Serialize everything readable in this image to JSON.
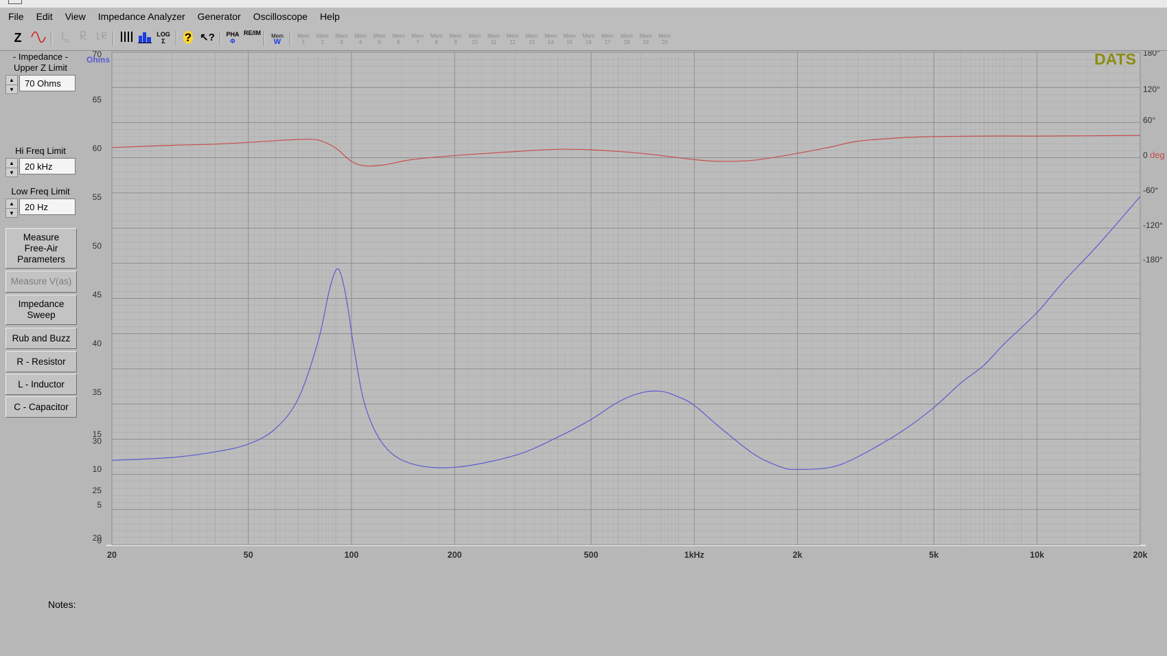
{
  "menubar": [
    "File",
    "Edit",
    "View",
    "Impedance Analyzer",
    "Generator",
    "Oscilloscope",
    "Help"
  ],
  "toolbar": {
    "z_label": "Z",
    "log_label": "LOG",
    "pha_label": "PHA",
    "re_im_label": "RE/IM",
    "mem_label": "Mem",
    "mem_slots": [
      "Mem 1",
      "Mem 2",
      "Mem 3",
      "Mem 4",
      "Mem 5",
      "Mem 6",
      "Mem 7",
      "Mem 8",
      "Mem 9",
      "Mem 10",
      "Mem 11",
      "Mem 12",
      "Mem 13",
      "Mem 14",
      "Mem 15",
      "Mem 16",
      "Mem 17",
      "Mem 18",
      "Mem 19",
      "Mem 20"
    ]
  },
  "sidebar": {
    "impedance_group": "- Impedance -",
    "upper_z_label": "Upper Z Limit",
    "upper_z_value": "70 Ohms",
    "hi_freq_label": "Hi Freq Limit",
    "hi_freq_value": "20 kHz",
    "low_freq_label": "Low Freq Limit",
    "low_freq_value": "20 Hz",
    "buttons": {
      "measure_free_air": [
        "Measure",
        "Free-Air",
        "Parameters"
      ],
      "measure_vas": "Measure V(as)",
      "impedance_sweep": [
        "Impedance",
        "Sweep"
      ],
      "rub_and_buzz": "Rub and Buzz",
      "r_resistor": "R - Resistor",
      "l_inductor": "L - Inductor",
      "c_capacitor": "C - Capacitor"
    }
  },
  "notes_label": "Notes:",
  "colors": {
    "impedance": "#5a5ad2",
    "phase": "#c84c4c",
    "brand": "#8c8c14",
    "grid_major": "#8c8c8c",
    "grid_minor": "#a7a7a7"
  },
  "chart_data": {
    "type": "line",
    "brand": "DATS",
    "x_scale": "log",
    "xlim": [
      20,
      20000
    ],
    "x_ticks": [
      20,
      50,
      100,
      200,
      500,
      1000,
      2000,
      5000,
      10000,
      20000
    ],
    "x_tick_labels": [
      "20",
      "50",
      "100",
      "200",
      "500",
      "1kHz",
      "2k",
      "5k",
      "10k",
      "20k"
    ],
    "y_unit_label": "Ohms",
    "y_tick_labels": [
      "70",
      "65",
      "60",
      "55",
      "50",
      "45",
      "40",
      "35",
      "15",
      "30",
      "10",
      "25",
      "5",
      "20",
      "0"
    ],
    "y2_unit_label": "deg",
    "y2lim": [
      -180,
      180
    ],
    "y2_tick_labels": [
      "180°",
      "120°",
      "60°",
      "0",
      "-60°",
      "-120°",
      "-180°"
    ],
    "grid": true,
    "series": [
      {
        "key": "impedance",
        "axis": "left",
        "points": [
          [
            20,
            12.0
          ],
          [
            30,
            12.4
          ],
          [
            40,
            13.2
          ],
          [
            50,
            14.3
          ],
          [
            60,
            16.5
          ],
          [
            70,
            20.8
          ],
          [
            80,
            29.0
          ],
          [
            86,
            36.0
          ],
          [
            90,
            39.0
          ],
          [
            93,
            38.5
          ],
          [
            97,
            34.5
          ],
          [
            102,
            27.5
          ],
          [
            110,
            19.5
          ],
          [
            125,
            14.0
          ],
          [
            150,
            11.5
          ],
          [
            200,
            11.0
          ],
          [
            300,
            12.7
          ],
          [
            400,
            15.3
          ],
          [
            500,
            17.8
          ],
          [
            600,
            20.3
          ],
          [
            700,
            21.6
          ],
          [
            800,
            21.8
          ],
          [
            900,
            21.0
          ],
          [
            1000,
            19.8
          ],
          [
            1200,
            16.5
          ],
          [
            1500,
            12.8
          ],
          [
            1800,
            11.0
          ],
          [
            2000,
            10.7
          ],
          [
            2500,
            11.0
          ],
          [
            3000,
            12.5
          ],
          [
            4000,
            16.0
          ],
          [
            5000,
            19.5
          ],
          [
            6000,
            23.0
          ],
          [
            7000,
            25.5
          ],
          [
            8000,
            28.5
          ],
          [
            10000,
            33.0
          ],
          [
            12000,
            37.5
          ],
          [
            15000,
            42.5
          ],
          [
            20000,
            49.5
          ]
        ]
      },
      {
        "key": "phase",
        "axis": "right",
        "points": [
          [
            20,
            14
          ],
          [
            30,
            18
          ],
          [
            40,
            20
          ],
          [
            50,
            23
          ],
          [
            60,
            26
          ],
          [
            70,
            28
          ],
          [
            80,
            27
          ],
          [
            90,
            13
          ],
          [
            100,
            -10
          ],
          [
            110,
            -18
          ],
          [
            125,
            -16
          ],
          [
            150,
            -7
          ],
          [
            200,
            0
          ],
          [
            300,
            7
          ],
          [
            400,
            11
          ],
          [
            500,
            10
          ],
          [
            700,
            4
          ],
          [
            1000,
            -7
          ],
          [
            1200,
            -10
          ],
          [
            1500,
            -8
          ],
          [
            2000,
            4
          ],
          [
            2500,
            15
          ],
          [
            3000,
            25
          ],
          [
            4000,
            31
          ],
          [
            5000,
            33
          ],
          [
            7000,
            34
          ],
          [
            10000,
            34
          ],
          [
            20000,
            35
          ]
        ]
      }
    ]
  }
}
